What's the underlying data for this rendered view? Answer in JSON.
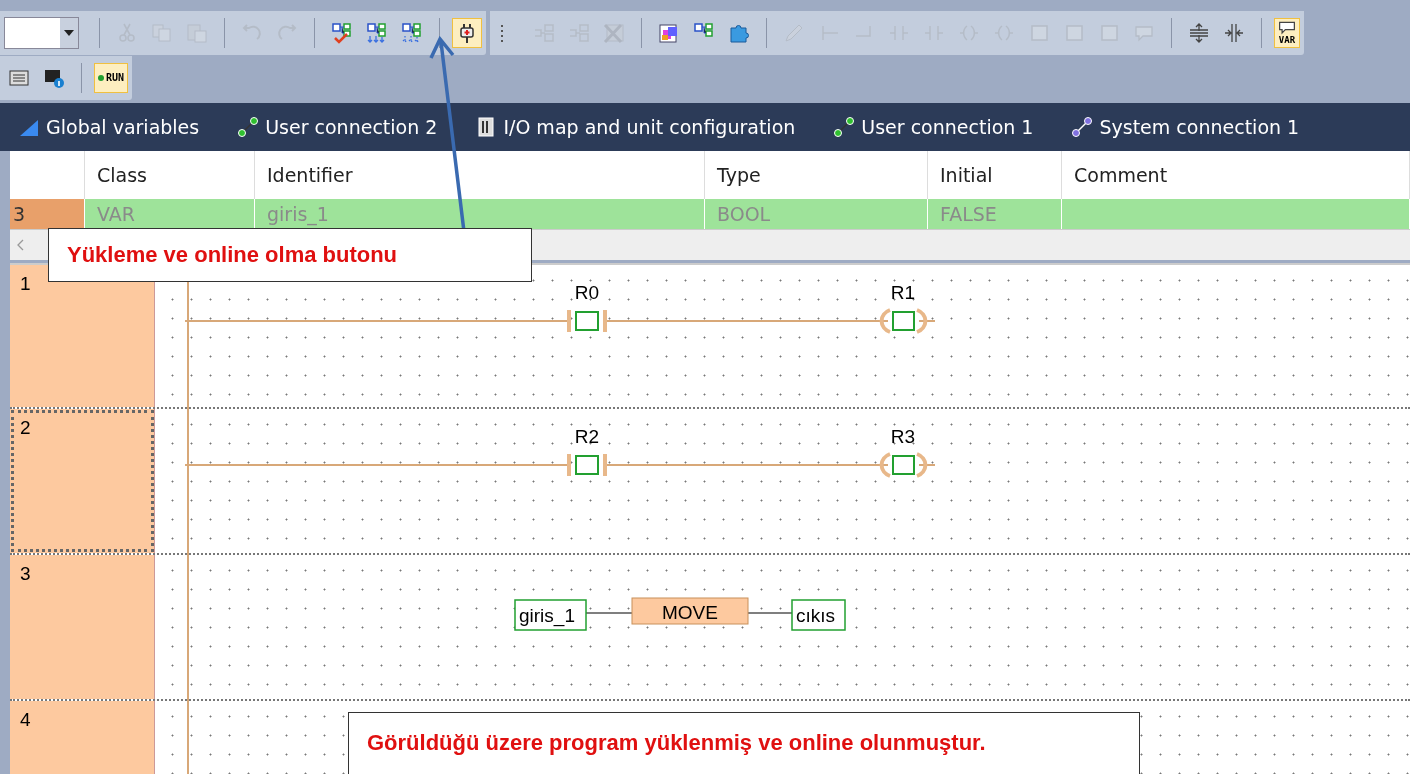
{
  "toolbar": {
    "rows": [
      {
        "strips": [
          {
            "groups": [
              {
                "items": [
                  {
                    "kind": "dropdown"
                  }
                ]
              },
              {
                "disabled": true,
                "items": [
                  {
                    "kind": "scissors",
                    "on": false
                  },
                  {
                    "kind": "pages",
                    "on": false
                  },
                  {
                    "kind": "clipboard",
                    "on": false
                  }
                ]
              },
              {
                "disabled": true,
                "items": [
                  {
                    "kind": "undo",
                    "on": false
                  },
                  {
                    "kind": "redo",
                    "on": false
                  }
                ]
              },
              {
                "disabled": false,
                "items": [
                  {
                    "kind": "tree-check",
                    "on": false
                  },
                  {
                    "kind": "tree-down",
                    "on": false
                  },
                  {
                    "kind": "tree-dots",
                    "on": false
                  }
                ]
              },
              {
                "disabled": false,
                "items": [
                  {
                    "kind": "plug",
                    "on": true
                  }
                ]
              }
            ]
          },
          {
            "groups": [
              {
                "disabled": true,
                "items": [
                  {
                    "kind": "grip"
                  },
                  {
                    "kind": "indent",
                    "on": false
                  },
                  {
                    "kind": "outdent",
                    "on": false
                  },
                  {
                    "kind": "cross-table",
                    "on": false
                  }
                ]
              },
              {
                "disabled": false,
                "items": [
                  {
                    "kind": "palette",
                    "on": false
                  },
                  {
                    "kind": "tree",
                    "on": false
                  },
                  {
                    "kind": "puzzle",
                    "on": false
                  }
                ]
              },
              {
                "disabled": true,
                "items": [
                  {
                    "kind": "pencil",
                    "on": false
                  },
                  {
                    "kind": "wire",
                    "on": false
                  },
                  {
                    "kind": "corner",
                    "on": false
                  },
                  {
                    "kind": "contact",
                    "on": false
                  },
                  {
                    "kind": "contact",
                    "on": false
                  },
                  {
                    "kind": "coil",
                    "on": false
                  },
                  {
                    "kind": "coil",
                    "on": false
                  },
                  {
                    "kind": "frame",
                    "on": false
                  },
                  {
                    "kind": "frame",
                    "on": false
                  },
                  {
                    "kind": "frame",
                    "on": false
                  },
                  {
                    "kind": "speech",
                    "on": false
                  }
                ]
              },
              {
                "disabled": false,
                "items": [
                  {
                    "kind": "spacing",
                    "on": false
                  },
                  {
                    "kind": "split",
                    "on": false
                  }
                ]
              },
              {
                "disabled": false,
                "items": [
                  {
                    "kind": "speech-var",
                    "on": true,
                    "label": "VAR"
                  }
                ]
              }
            ]
          }
        ]
      },
      {
        "strips": [
          {
            "groups": [
              {
                "disabled": false,
                "items": [
                  {
                    "kind": "device",
                    "on": false
                  },
                  {
                    "kind": "device-info",
                    "on": false
                  }
                ]
              },
              {
                "disabled": false,
                "items": [
                  {
                    "kind": "run",
                    "on": true,
                    "label": "RUN"
                  }
                ]
              }
            ]
          }
        ]
      }
    ]
  },
  "tabs": [
    {
      "kind": "variables",
      "label": "Global variables"
    },
    {
      "kind": "connection",
      "label": "User connection 2"
    },
    {
      "kind": "io-map",
      "label": "I/O map and unit configuration"
    },
    {
      "kind": "connection",
      "label": "User connection 1"
    },
    {
      "kind": "system-connection",
      "label": "System connection 1"
    }
  ],
  "table": {
    "columns": [
      "Class",
      "Identifier",
      "Type",
      "Initial",
      "Comment"
    ],
    "rows": [
      {
        "number": "3",
        "cells": [
          "VAR",
          "giris_1",
          "BOOL",
          "FALSE",
          ""
        ],
        "selected": true
      }
    ]
  },
  "ladder": {
    "rungs": [
      {
        "number": "1",
        "selected": false,
        "elements": [
          {
            "kind": "contact",
            "label": "R0"
          },
          {
            "kind": "coil",
            "label": "R1"
          }
        ]
      },
      {
        "number": "2",
        "selected": true,
        "elements": [
          {
            "kind": "contact",
            "label": "R2"
          },
          {
            "kind": "coil",
            "label": "R3"
          }
        ]
      },
      {
        "number": "3",
        "selected": false,
        "elements": [
          {
            "kind": "input",
            "label": "giris_1"
          },
          {
            "kind": "function",
            "label": "MOVE"
          },
          {
            "kind": "output",
            "label": "cıkıs"
          }
        ]
      },
      {
        "number": "4",
        "selected": false
      }
    ]
  },
  "annotations": [
    {
      "kind": "pointer",
      "text": "Yükleme ve online olma butonu"
    },
    {
      "kind": "note",
      "text": "Görüldüğü üzere program yüklenmiş ve online olunmuştur."
    }
  ]
}
